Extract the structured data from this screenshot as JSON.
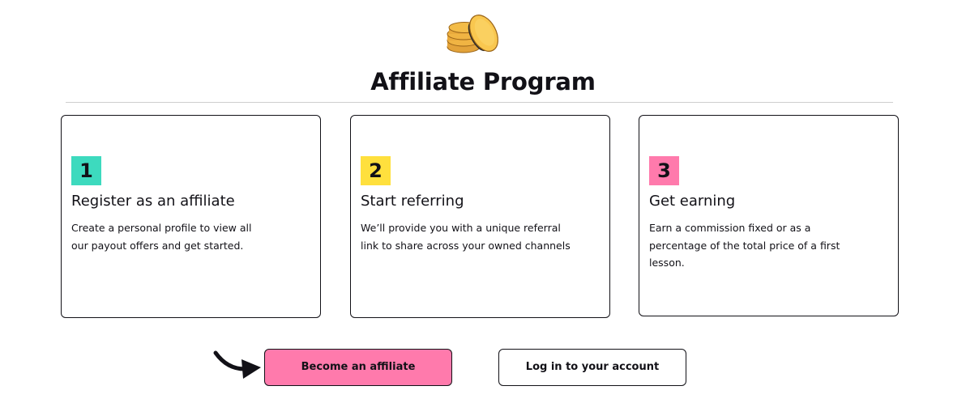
{
  "header": {
    "icon": "coins-stack-icon",
    "title": "Affiliate Program"
  },
  "steps": [
    {
      "number": "1",
      "color": "#3DDABE",
      "title": "Register as an affiliate",
      "description": "Create a personal profile to view all our payout offers and get started."
    },
    {
      "number": "2",
      "color": "#FFE03D",
      "title": "Start referring",
      "description": "We’ll provide you with a unique referral link to share across your owned channels"
    },
    {
      "number": "3",
      "color": "#FF7AAC",
      "title": "Get earning",
      "description": "Earn a commission fixed or as a percentage of the total price of a first lesson."
    }
  ],
  "actions": {
    "primary_label": "Become an affiliate",
    "primary_color": "#FF7AAC",
    "secondary_label": "Log in to your account",
    "arrow_icon": "curved-arrow-right-icon"
  }
}
